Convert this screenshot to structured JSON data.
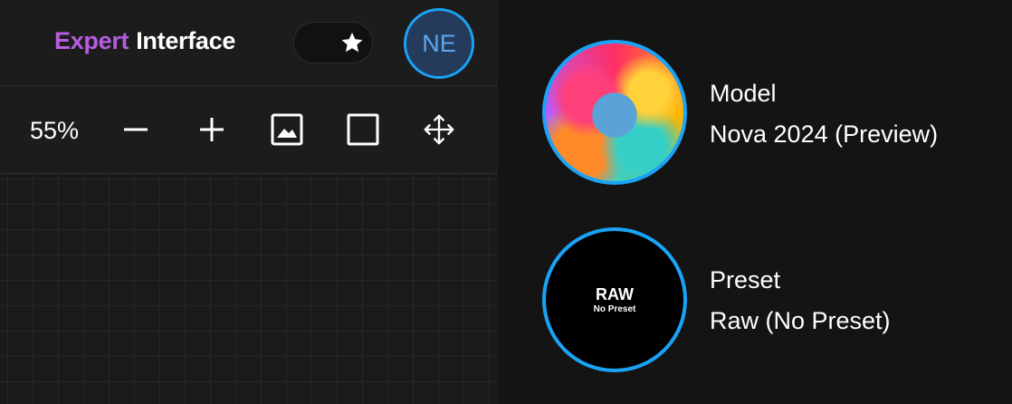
{
  "header": {
    "brand_word1": "Expert",
    "brand_word2": "Interface",
    "favorite_icon": "star-icon",
    "avatar_initials": "NE"
  },
  "toolbar": {
    "zoom_level": "55%",
    "tools": [
      "minus-icon",
      "plus-icon",
      "image-icon",
      "square-icon",
      "move-icon"
    ]
  },
  "model": {
    "title": "Model",
    "value": "Nova 2024 (Preview)"
  },
  "preset": {
    "title": "Preset",
    "value": "Raw (No Preset)",
    "thumb_main": "RAW",
    "thumb_sub": "No Preset"
  },
  "colors": {
    "accent_blue": "#1aa3f5",
    "brand_purple": "#b65ce0"
  }
}
